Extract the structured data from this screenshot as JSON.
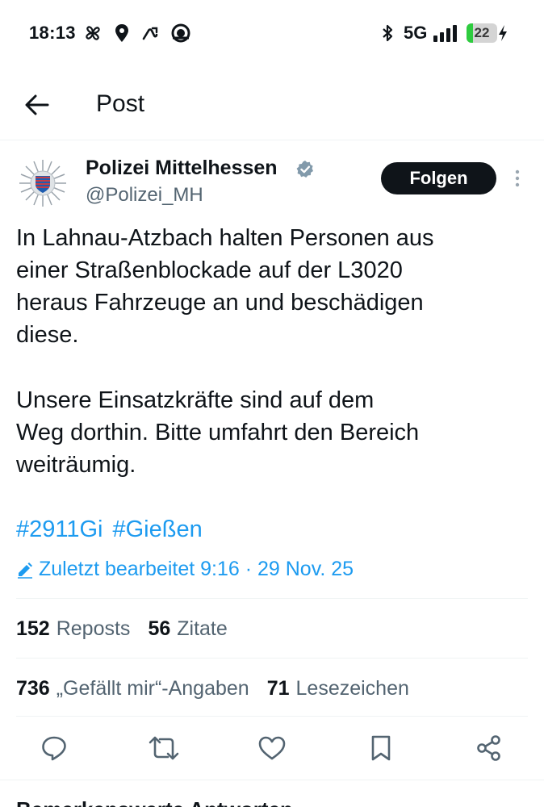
{
  "status_bar": {
    "time": "18:13",
    "network": "5G",
    "battery": "22",
    "battery_level_percent": 22,
    "icons": [
      "pinwheel-icon",
      "location-icon",
      "route-icon",
      "cloud-icon",
      "bluetooth-icon",
      "signal-icon",
      "battery-icon",
      "charging-icon"
    ]
  },
  "header": {
    "title": "Post",
    "back_icon": "back-arrow-icon"
  },
  "post": {
    "author_name": "Polizei Mittelhessen",
    "handle": "@Polizei_MH",
    "follow_label": "Folgen",
    "text_lines": [
      "In Lahnau-Atzbach halten Personen aus",
      "einer Straßenblockade auf der L3020",
      "heraus Fahrzeuge an und beschädigen",
      "diese."
    ],
    "text_lines_2": [
      "Unsere Einsatzkräfte sind auf dem",
      "Weg dorthin. Bitte umfahrt den Bereich",
      "weiträumig."
    ],
    "hashtags": [
      "#2911Gi",
      "#Gießen"
    ],
    "edited": "Zuletzt bearbeitet 9:16 · 29 Nov. 25"
  },
  "stats": {
    "reposts_count": "152",
    "reposts_label": "Reposts",
    "quotes_count": "56",
    "quotes_label": "Zitate",
    "likes_count": "736",
    "likes_label": "„Gefällt mir“-Angaben",
    "bookmarks_count": "71",
    "bookmarks_label": "Lesezeichen"
  },
  "actions": [
    "reply-icon",
    "repost-icon",
    "like-icon",
    "bookmark-icon",
    "share-icon"
  ],
  "bottom": {
    "text": "Bemerkenswerte Antworten"
  },
  "colors": {
    "accent": "#1d9bf0",
    "text": "#0f1419",
    "secondary": "#536471",
    "battery_green": "#2ecc3f"
  }
}
